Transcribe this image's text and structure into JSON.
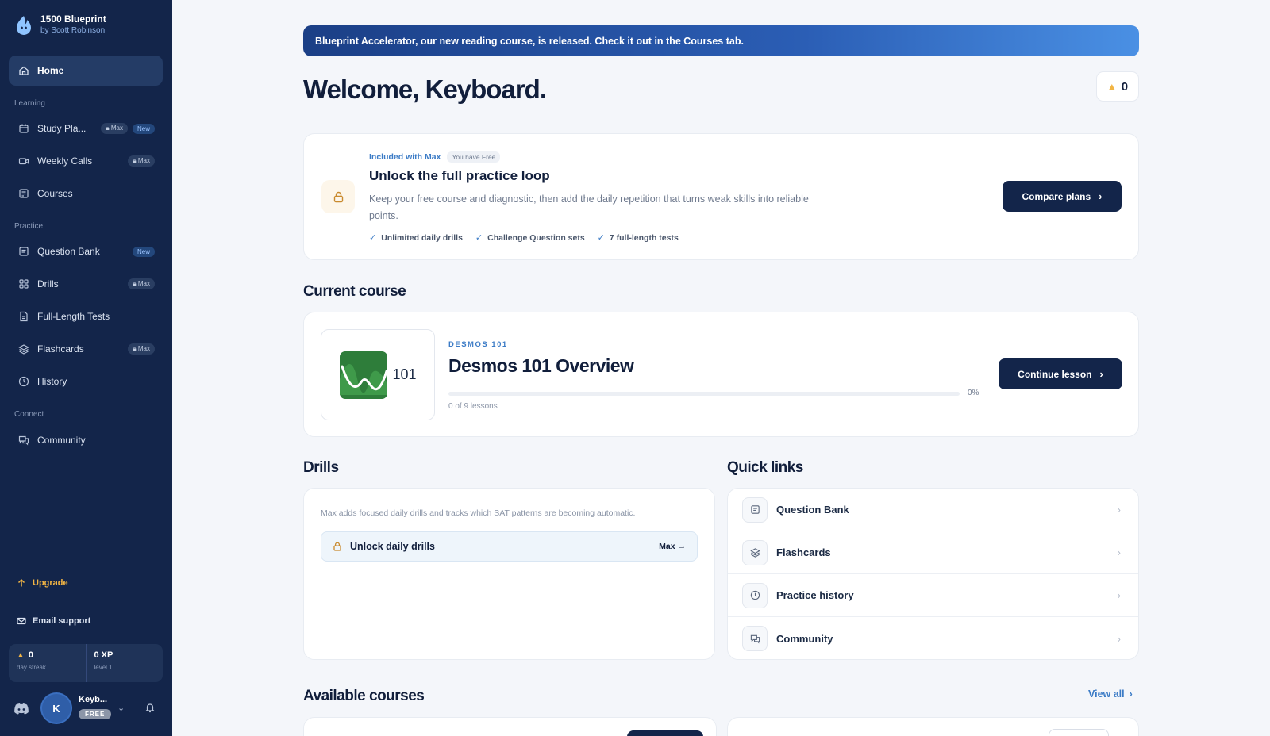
{
  "brand": {
    "title": "1500 Blueprint",
    "subtitle": "by Scott Robinson"
  },
  "sidebar": {
    "home": "Home",
    "sections": {
      "learning": "Learning",
      "practice": "Practice",
      "connect": "Connect"
    },
    "items": [
      {
        "label": "Study Pla...",
        "badges": [
          "Max",
          "New"
        ]
      },
      {
        "label": "Weekly Calls",
        "badges": [
          "Max"
        ]
      },
      {
        "label": "Courses",
        "badges": []
      },
      {
        "label": "Question Bank",
        "badges": [
          "New"
        ]
      },
      {
        "label": "Drills",
        "badges": [
          "Max"
        ]
      },
      {
        "label": "Full-Length Tests",
        "badges": []
      },
      {
        "label": "Flashcards",
        "badges": [
          "Max"
        ]
      },
      {
        "label": "History",
        "badges": []
      },
      {
        "label": "Community",
        "badges": []
      }
    ],
    "upgrade": "Upgrade",
    "email_support": "Email support",
    "stats": {
      "streak_value": "0",
      "streak_label": "day streak",
      "xp_value": "0 XP",
      "xp_label": "level 1"
    },
    "user": {
      "initial": "K",
      "name": "Keyb...",
      "plan": "FREE"
    }
  },
  "banner": {
    "text": "Blueprint Accelerator, our new reading course, is released. Check it out in the Courses tab."
  },
  "welcome": "Welcome, Keyboard.",
  "streak_count": "0",
  "unlock_card": {
    "eyebrow": "Included with Max",
    "plan_pill": "You have Free",
    "title": "Unlock the full practice loop",
    "description": "Keep your free course and diagnostic, then add the daily repetition that turns weak skills into reliable points.",
    "checks": [
      "Unlimited daily drills",
      "Challenge Question sets",
      "7 full-length tests"
    ],
    "button": "Compare plans"
  },
  "current_course": {
    "heading": "Current course",
    "thumb_text": "101",
    "eyebrow": "DESMOS 101",
    "title": "Desmos 101 Overview",
    "progress": 0,
    "progress_label": "0%",
    "lessons": "0 of 9 lessons",
    "button": "Continue lesson"
  },
  "drills": {
    "heading": "Drills",
    "description": "Max adds focused daily drills and tracks which SAT patterns are becoming automatic.",
    "unlock_label": "Unlock daily drills",
    "unlock_cta": "Max →"
  },
  "quick_links": {
    "heading": "Quick links",
    "items": [
      "Question Bank",
      "Flashcards",
      "Practice history",
      "Community"
    ]
  },
  "available_courses": {
    "heading": "Available courses",
    "view_all": "View all"
  },
  "colors": {
    "sidebar": "#13254a",
    "accent": "#3b7bc6",
    "streak": "#f2b544",
    "primary_button": "#13254a"
  }
}
